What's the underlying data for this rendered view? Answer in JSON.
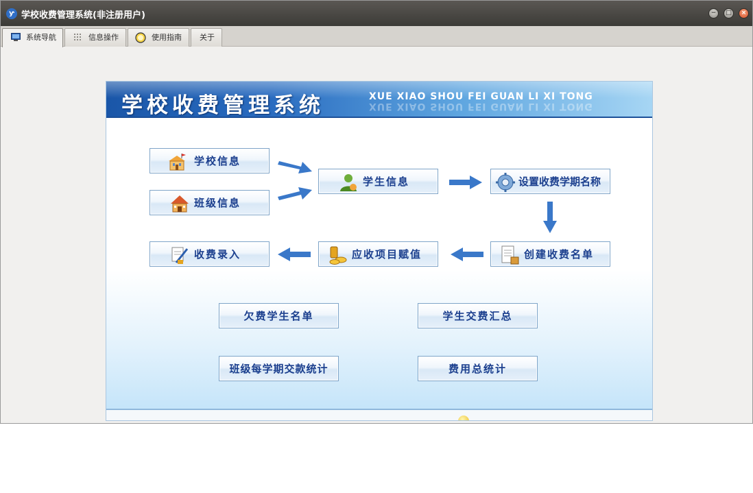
{
  "window": {
    "title": "学校收费管理系统(非注册用户)",
    "app_icon_text": "ƴ"
  },
  "tabs": [
    {
      "label": "系统导航",
      "icon": "monitor-icon",
      "active": true
    },
    {
      "label": "信息操作",
      "icon": "grid-icon",
      "active": false
    },
    {
      "label": "使用指南",
      "icon": "help-circle-icon",
      "active": false
    },
    {
      "label": "关于",
      "icon": "",
      "active": false
    }
  ],
  "banner": {
    "title_cn": "学校收费管理系统",
    "title_en": "XUE XIAO SHOU FEI GUAN LI XI TONG"
  },
  "flow": {
    "school_info": "学校信息",
    "class_info": "班级信息",
    "student_info": "学生信息",
    "set_term_name": "设置收费学期名称",
    "create_fee_list": "创建收费名单",
    "assign_items": "应收项目赋值",
    "fee_entry": "收费录入"
  },
  "reports": {
    "arrears_list": "欠费学生名单",
    "payment_summary": "学生交费汇总",
    "class_term_stats": "班级每学期交款统计",
    "total_stats": "费用总统计"
  },
  "colors": {
    "title_bar": "#3c3b37",
    "banner_blue": "#1a56a8",
    "button_text": "#1b3f8e",
    "arrow_blue": "#3a78c9"
  }
}
